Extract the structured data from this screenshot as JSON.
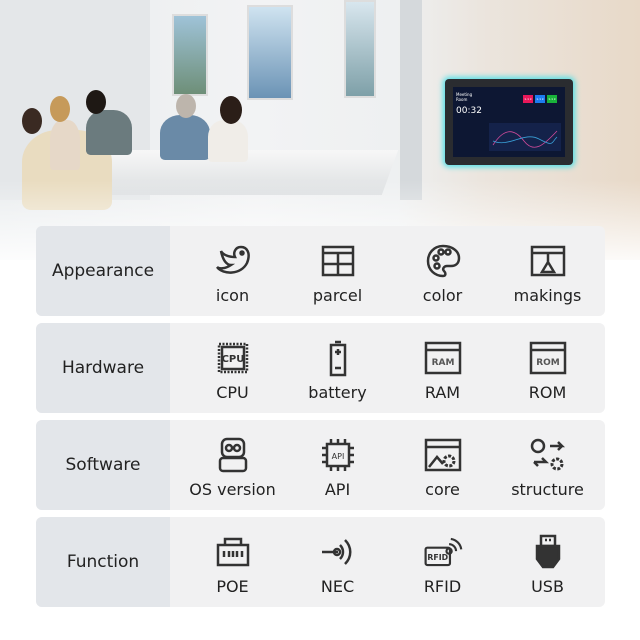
{
  "device_screen": {
    "room": "Meeting Room",
    "time": "00:32",
    "kpis": [
      {
        "value": "1.1 k",
        "color": "#e8185a"
      },
      {
        "value": "1.1 k",
        "color": "#1c7cf0"
      },
      {
        "value": "1.1 k",
        "color": "#19b33a"
      }
    ],
    "glow_color": "#4fe0e8"
  },
  "rows": [
    {
      "category": "Appearance",
      "items": [
        {
          "label": "icon",
          "icon": "bird-icon"
        },
        {
          "label": "parcel",
          "icon": "grid-icon"
        },
        {
          "label": "color",
          "icon": "palette-icon"
        },
        {
          "label": "makings",
          "icon": "window-icon"
        }
      ]
    },
    {
      "category": "Hardware",
      "items": [
        {
          "label": "CPU",
          "icon": "cpu-icon"
        },
        {
          "label": "battery",
          "icon": "battery-icon"
        },
        {
          "label": "RAM",
          "icon": "ram-icon"
        },
        {
          "label": "ROM",
          "icon": "rom-icon"
        }
      ]
    },
    {
      "category": "Software",
      "items": [
        {
          "label": "OS version",
          "icon": "robot-icon"
        },
        {
          "label": "API",
          "icon": "api-chip-icon"
        },
        {
          "label": "core",
          "icon": "gear-window-icon"
        },
        {
          "label": "structure",
          "icon": "structure-icon"
        }
      ]
    },
    {
      "category": "Function",
      "items": [
        {
          "label": "POE",
          "icon": "ethernet-port-icon"
        },
        {
          "label": "NEC",
          "icon": "nfc-icon"
        },
        {
          "label": "RFID",
          "icon": "rfid-icon"
        },
        {
          "label": "USB",
          "icon": "usb-icon"
        }
      ]
    }
  ],
  "icon_text": {
    "cpu": "CPU",
    "ram": "RAM",
    "rom": "ROM",
    "api": "API",
    "rfid": "RFID"
  }
}
